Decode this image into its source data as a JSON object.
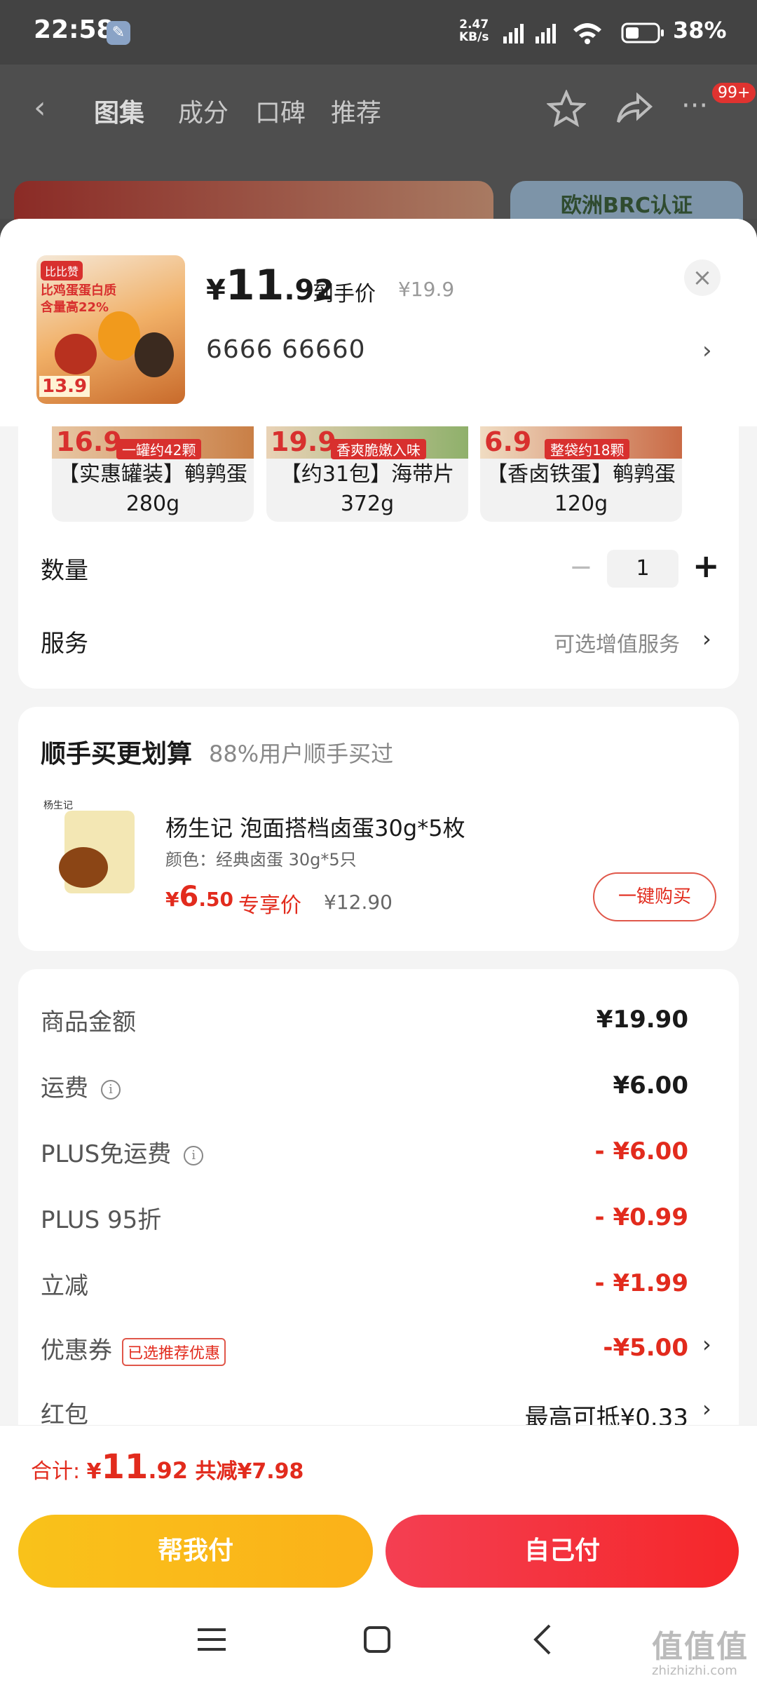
{
  "status_bar": {
    "time": "22:58",
    "net_speed": "2.47\nKB/s",
    "battery": "38%"
  },
  "bg_nav": {
    "tabs": [
      "图集",
      "成分",
      "口碑",
      "推荐"
    ],
    "badge": "99+",
    "banner2": "欧洲BRC认证"
  },
  "product": {
    "price_currency": "¥",
    "price_int": "11",
    "price_dec": ".92",
    "price_label": "到手价",
    "orig_price": "¥19.9",
    "variant": "6666  66660",
    "thumb_brand": "比比赞",
    "thumb_line1": "比鸡蛋蛋白质",
    "thumb_line2": "含量高22%",
    "thumb_price": "13.9"
  },
  "options": [
    {
      "price": "16.9",
      "tag": "一罐约42颗",
      "name": "【实惠罐装】鹌鹑蛋 280g"
    },
    {
      "price": "19.9",
      "tag": "香爽脆嫩入味",
      "name": "【约31包】海带片 372g"
    },
    {
      "price": "6.9",
      "tag": "整袋约18颗",
      "name": "【香卤铁蛋】鹌鹑蛋 120g"
    }
  ],
  "quantity": {
    "label": "数量",
    "minus": "−",
    "value": "1",
    "plus": "+"
  },
  "service": {
    "label": "服务",
    "value": "可选增值服务"
  },
  "addon": {
    "title": "顺手买更划算",
    "subtitle": "88%用户顺手买过",
    "name": "杨生记 泡面搭档卤蛋30g*5枚",
    "spec": "颜色：经典卤蛋 30g*5只",
    "price_currency": "¥",
    "price_int": "6",
    "price_dec": ".50",
    "price_label": "专享价",
    "orig_price": "¥12.90",
    "button": "一键购买",
    "logo": "杨生记"
  },
  "summary": {
    "goods_label": "商品金额",
    "goods_value": "¥19.90",
    "shipping_label": "运费",
    "shipping_value": "¥6.00",
    "plus_ship_label": "PLUS免运费",
    "plus_ship_value": "- ¥6.00",
    "plus95_label": "PLUS 95折",
    "plus95_value": "- ¥0.99",
    "instant_label": "立减",
    "instant_value": "- ¥1.99",
    "coupon_label": "优惠券",
    "coupon_tag": "已选推荐优惠",
    "coupon_value": "-¥5.00",
    "redpacket_label": "红包",
    "redpacket_value": "最高可抵¥0.33"
  },
  "total": {
    "label": "合计: ",
    "currency": "¥",
    "int": "11",
    "dec": ".92",
    "saved": " 共减¥7.98"
  },
  "buttons": {
    "help_pay": "帮我付",
    "self_pay": "自己付"
  },
  "watermark": {
    "text": "值值值",
    "sub": "zhizhizhi.com"
  },
  "colors": {
    "accent_red": "#e22b1d",
    "help_btn": "#f9c21a",
    "self_btn": "#f5272a"
  }
}
